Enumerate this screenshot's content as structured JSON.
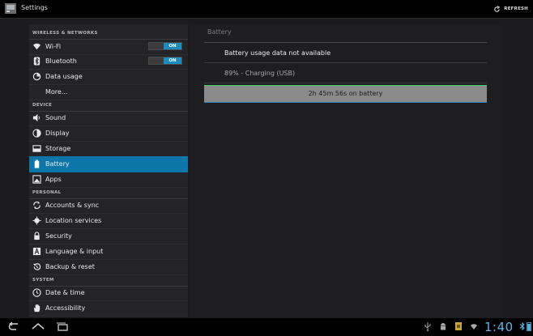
{
  "actionbar": {
    "title": "Settings",
    "refresh_label": "REFRESH"
  },
  "sidebar": {
    "sections": {
      "wireless": "WIRELESS & NETWORKS",
      "device": "DEVICE",
      "personal": "PERSONAL",
      "system": "SYSTEM"
    },
    "wifi": {
      "label": "Wi-Fi",
      "toggle": "ON"
    },
    "bluetooth": {
      "label": "Bluetooth",
      "toggle": "ON"
    },
    "data_usage": "Data usage",
    "more": "More...",
    "sound": "Sound",
    "display": "Display",
    "storage": "Storage",
    "battery": "Battery",
    "apps": "Apps",
    "accounts": "Accounts & sync",
    "location": "Location services",
    "security": "Security",
    "language": "Language & input",
    "backup": "Backup & reset",
    "datetime": "Date & time",
    "accessibility": "Accessibility"
  },
  "detail": {
    "title": "Battery",
    "usage_message": "Battery usage data not available",
    "charge_status": "89% - Charging (USB)",
    "time_on_battery": "2h 45m 56s on battery"
  },
  "statusbar": {
    "clock": "1:40"
  },
  "colors": {
    "selected": "#0d76a8",
    "toggle_on": "#1a8cc0",
    "clock": "#5fb7e8"
  }
}
